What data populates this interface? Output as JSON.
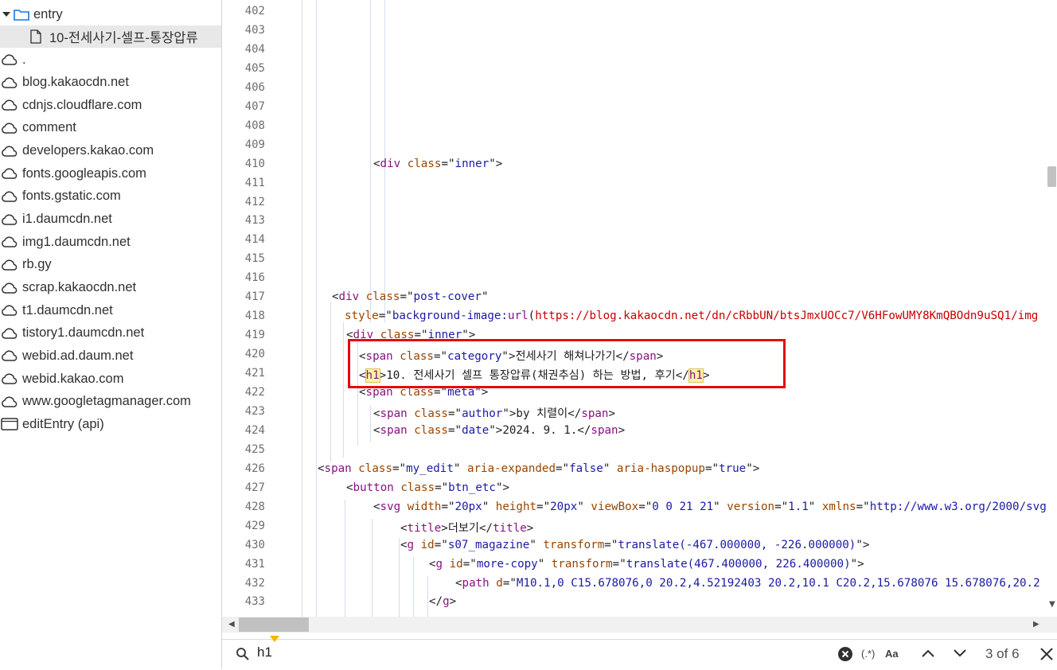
{
  "sidebar": {
    "folder": {
      "label": "entry",
      "expanded": true
    },
    "selected_file": "10-전세사기-셀프-통장압류",
    "items": [
      ".",
      "blog.kakaocdn.net",
      "cdnjs.cloudflare.com",
      "comment",
      "developers.kakao.com",
      "fonts.googleapis.com",
      "fonts.gstatic.com",
      "i1.daumcdn.net",
      "img1.daumcdn.net",
      "rb.gy",
      "scrap.kakaocdn.net",
      "t1.daumcdn.net",
      "tistory1.daumcdn.net",
      "webid.ad.daum.net",
      "webid.kakao.com",
      "www.googletagmanager.com"
    ],
    "api_item": "editEntry (api)"
  },
  "editor": {
    "line_numbers": [
      "402",
      "403",
      "404",
      "405",
      "406",
      "407",
      "408",
      "409",
      "410",
      "411",
      "412",
      "413",
      "414",
      "415",
      "416",
      "417",
      "418",
      "419",
      "420",
      "421",
      "422",
      "423",
      "424",
      "425",
      "426",
      "427",
      "428",
      "429",
      "430",
      "431",
      "432",
      "433"
    ],
    "lines": [
      {
        "ln": "410",
        "parts": [
          [
            "p",
            "<"
          ],
          [
            "t",
            "div"
          ],
          [
            "p",
            " "
          ],
          [
            "a",
            "class"
          ],
          [
            "p",
            "=\""
          ],
          [
            "v",
            "inner"
          ],
          [
            "p",
            "\">"
          ]
        ]
      },
      {
        "ln": "417",
        "parts": [
          [
            "p",
            "<"
          ],
          [
            "t",
            "div"
          ],
          [
            "p",
            " "
          ],
          [
            "a",
            "class"
          ],
          [
            "p",
            "=\""
          ],
          [
            "v",
            "post-cover"
          ],
          [
            "p",
            "\""
          ]
        ]
      },
      {
        "ln": "418",
        "parts": [
          [
            "a",
            "style"
          ],
          [
            "p",
            "=\""
          ],
          [
            "v",
            "background-image:"
          ],
          [
            "t",
            "url"
          ],
          [
            "p",
            "("
          ],
          [
            "u",
            "https://blog.kakaocdn.net/dn/cRbbUN/btsJmxUOCc7/V6HFowUMY8KmQBOdn9uSQ1/img"
          ]
        ]
      },
      {
        "ln": "419",
        "parts": [
          [
            "p",
            "<"
          ],
          [
            "t",
            "div"
          ],
          [
            "p",
            " "
          ],
          [
            "a",
            "class"
          ],
          [
            "p",
            "=\""
          ],
          [
            "v",
            "inner"
          ],
          [
            "p",
            "\">"
          ]
        ]
      },
      {
        "ln": "420",
        "parts": [
          [
            "p",
            "<"
          ],
          [
            "t",
            "span"
          ],
          [
            "p",
            " "
          ],
          [
            "a",
            "class"
          ],
          [
            "p",
            "=\""
          ],
          [
            "v",
            "category"
          ],
          [
            "p",
            "\">"
          ],
          [
            "x",
            "전세사기 해쳐나가기"
          ],
          [
            "p",
            "</"
          ],
          [
            "t",
            "span"
          ],
          [
            "p",
            ">"
          ]
        ]
      },
      {
        "ln": "421",
        "parts": [
          [
            "p",
            "<"
          ],
          [
            "h",
            "h1"
          ],
          [
            "p",
            ">"
          ],
          [
            "x",
            "10. 전세사기 셀프 통장압류(채권추심) 하는 방법, 후기"
          ],
          [
            "p",
            "</"
          ],
          [
            "h",
            "h1"
          ],
          [
            "p",
            ">"
          ]
        ]
      },
      {
        "ln": "422",
        "parts": [
          [
            "p",
            "<"
          ],
          [
            "t",
            "span"
          ],
          [
            "p",
            " "
          ],
          [
            "a",
            "class"
          ],
          [
            "p",
            "=\""
          ],
          [
            "v",
            "meta"
          ],
          [
            "p",
            "\">"
          ]
        ]
      },
      {
        "ln": "423",
        "parts": [
          [
            "p",
            "<"
          ],
          [
            "t",
            "span"
          ],
          [
            "p",
            " "
          ],
          [
            "a",
            "class"
          ],
          [
            "p",
            "=\""
          ],
          [
            "v",
            "author"
          ],
          [
            "p",
            "\">"
          ],
          [
            "x",
            "by 치렬이"
          ],
          [
            "p",
            "</"
          ],
          [
            "t",
            "span"
          ],
          [
            "p",
            ">"
          ]
        ]
      },
      {
        "ln": "424",
        "parts": [
          [
            "p",
            "<"
          ],
          [
            "t",
            "span"
          ],
          [
            "p",
            " "
          ],
          [
            "a",
            "class"
          ],
          [
            "p",
            "=\""
          ],
          [
            "v",
            "date"
          ],
          [
            "p",
            "\">"
          ],
          [
            "x",
            "2024. 9. 1."
          ],
          [
            "p",
            "</"
          ],
          [
            "t",
            "span"
          ],
          [
            "p",
            ">"
          ]
        ]
      },
      {
        "ln": "426",
        "parts": [
          [
            "p",
            "<"
          ],
          [
            "t",
            "span"
          ],
          [
            "p",
            " "
          ],
          [
            "a",
            "class"
          ],
          [
            "p",
            "=\""
          ],
          [
            "v",
            "my_edit"
          ],
          [
            "p",
            "\" "
          ],
          [
            "a",
            "aria-expanded"
          ],
          [
            "p",
            "=\""
          ],
          [
            "v",
            "false"
          ],
          [
            "p",
            "\" "
          ],
          [
            "a",
            "aria-haspopup"
          ],
          [
            "p",
            "=\""
          ],
          [
            "v",
            "true"
          ],
          [
            "p",
            "\">"
          ]
        ]
      },
      {
        "ln": "427",
        "parts": [
          [
            "p",
            "<"
          ],
          [
            "t",
            "button"
          ],
          [
            "p",
            " "
          ],
          [
            "a",
            "class"
          ],
          [
            "p",
            "=\""
          ],
          [
            "v",
            "btn_etc"
          ],
          [
            "p",
            "\">"
          ]
        ]
      },
      {
        "ln": "428",
        "parts": [
          [
            "p",
            "<"
          ],
          [
            "t",
            "svg"
          ],
          [
            "p",
            " "
          ],
          [
            "a",
            "width"
          ],
          [
            "p",
            "=\""
          ],
          [
            "v",
            "20px"
          ],
          [
            "p",
            "\" "
          ],
          [
            "a",
            "height"
          ],
          [
            "p",
            "=\""
          ],
          [
            "v",
            "20px"
          ],
          [
            "p",
            "\" "
          ],
          [
            "a",
            "viewBox"
          ],
          [
            "p",
            "=\""
          ],
          [
            "v",
            "0 0 21 21"
          ],
          [
            "p",
            "\" "
          ],
          [
            "a",
            "version"
          ],
          [
            "p",
            "=\""
          ],
          [
            "v",
            "1.1"
          ],
          [
            "p",
            "\" "
          ],
          [
            "a",
            "xmlns"
          ],
          [
            "p",
            "=\""
          ],
          [
            "v",
            "http://www.w3.org/2000/svg"
          ]
        ]
      },
      {
        "ln": "429",
        "parts": [
          [
            "p",
            "<"
          ],
          [
            "t",
            "title"
          ],
          [
            "p",
            ">"
          ],
          [
            "x",
            "더보기"
          ],
          [
            "p",
            "</"
          ],
          [
            "t",
            "title"
          ],
          [
            "p",
            ">"
          ]
        ]
      },
      {
        "ln": "430",
        "parts": [
          [
            "p",
            "<"
          ],
          [
            "t",
            "g"
          ],
          [
            "p",
            " "
          ],
          [
            "a",
            "id"
          ],
          [
            "p",
            "=\""
          ],
          [
            "v",
            "s07_magazine"
          ],
          [
            "p",
            "\" "
          ],
          [
            "a",
            "transform"
          ],
          [
            "p",
            "=\""
          ],
          [
            "v",
            "translate(-467.000000, -226.000000)"
          ],
          [
            "p",
            "\">"
          ]
        ]
      },
      {
        "ln": "431",
        "parts": [
          [
            "p",
            "<"
          ],
          [
            "t",
            "g"
          ],
          [
            "p",
            " "
          ],
          [
            "a",
            "id"
          ],
          [
            "p",
            "=\""
          ],
          [
            "v",
            "more-copy"
          ],
          [
            "p",
            "\" "
          ],
          [
            "a",
            "transform"
          ],
          [
            "p",
            "=\""
          ],
          [
            "v",
            "translate(467.400000, 226.400000)"
          ],
          [
            "p",
            "\">"
          ]
        ]
      },
      {
        "ln": "432",
        "parts": [
          [
            "p",
            "<"
          ],
          [
            "t",
            "path"
          ],
          [
            "p",
            " "
          ],
          [
            "a",
            "d"
          ],
          [
            "p",
            "=\""
          ],
          [
            "v",
            "M10.1,0 C15.678076,0 20.2,4.52192403 20.2,10.1 C20.2,15.678076 15.678076,20.2"
          ]
        ]
      },
      {
        "ln": "433",
        "parts": [
          [
            "p",
            "</"
          ],
          [
            "t",
            "g"
          ],
          [
            "p",
            ">"
          ]
        ]
      }
    ]
  },
  "search": {
    "query": "h1",
    "match_count": "3 of 6",
    "regex_label": "(.*)",
    "case_label": "Aa"
  }
}
